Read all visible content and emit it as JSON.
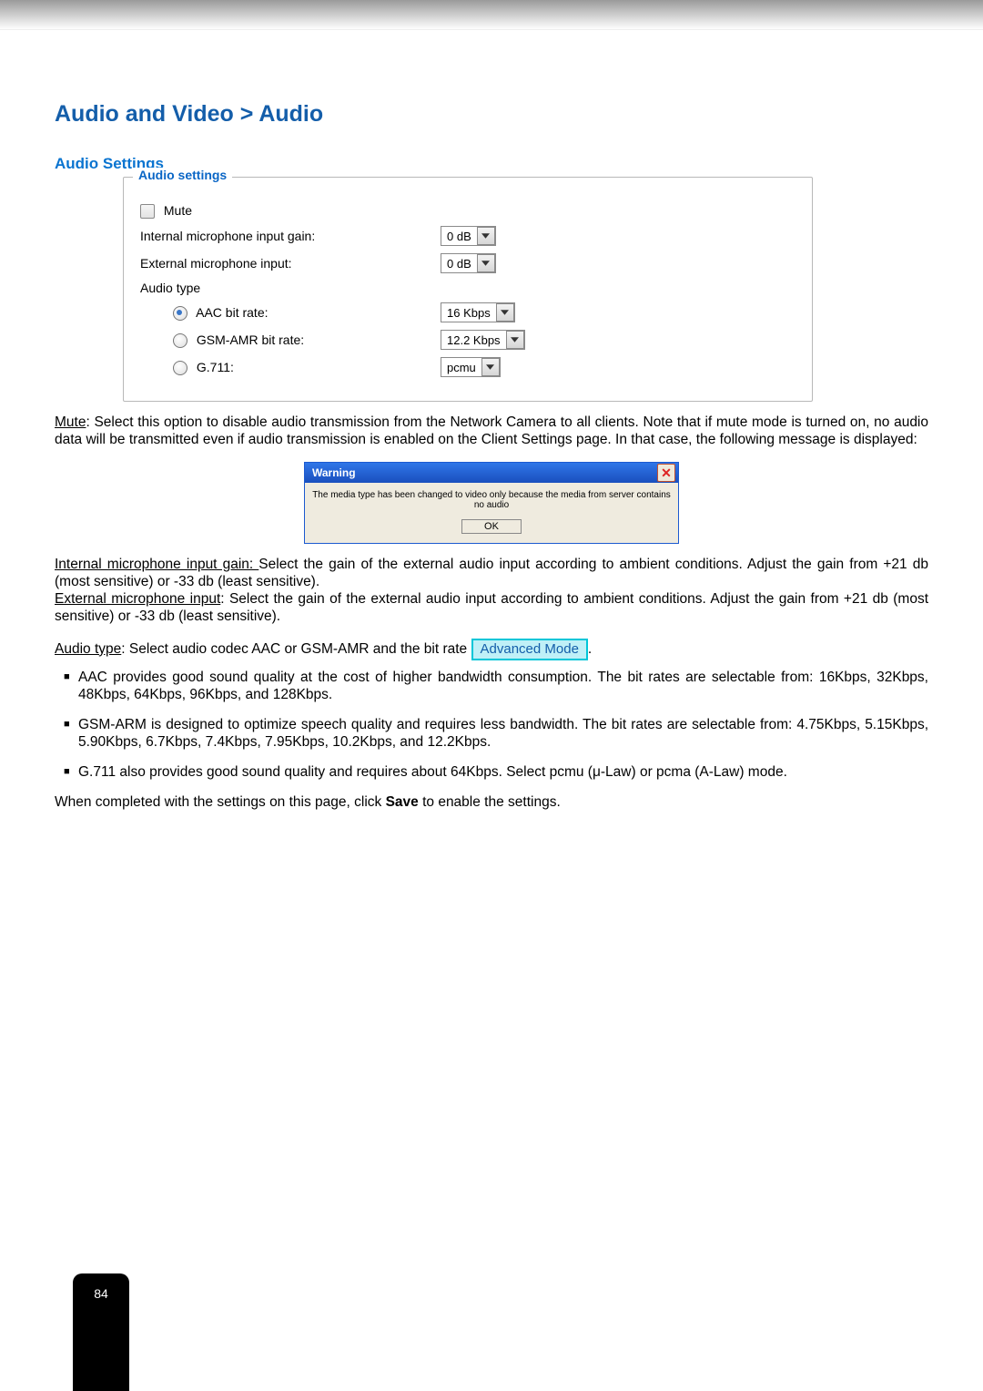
{
  "breadcrumb": "Audio and Video > Audio",
  "sectionTitle": "Audio Settings",
  "fieldset": {
    "legend": "Audio settings",
    "muteLabel": "Mute",
    "internalGainLabel": "Internal microphone input gain:",
    "internalGainValue": "0 dB",
    "externalInputLabel": "External microphone input:",
    "externalInputValue": "0 dB",
    "audioTypeLabel": "Audio type",
    "aacLabel": "AAC bit rate:",
    "aacValue": "16 Kbps",
    "gsmLabel": "GSM-AMR bit rate:",
    "gsmValue": "12.2 Kbps",
    "g711Label": "G.711:",
    "g711Value": "pcmu"
  },
  "muteParagraph": {
    "lead": "Mute",
    "text": ": Select this option to disable audio transmission from the Network Camera to all clients. Note that if mute mode is turned on, no audio data will be transmitted even if audio transmission is enabled on the Client Settings page. In that case, the following message is displayed:"
  },
  "dialog": {
    "title": "Warning",
    "message": "The media type has been changed to video only because the media from server contains no audio",
    "ok": "OK"
  },
  "internalPara": {
    "lead": "Internal microphone input gain: ",
    "text": "Select the gain of the external audio input according to ambient conditions. Adjust the gain from +21 db (most sensitive) or -33 db (least sensitive)."
  },
  "externalPara": {
    "lead": "External microphone input",
    "text": ": Select the gain of the external audio input according to ambient conditions. Adjust the gain from +21 db (most sensitive) or -33 db (least sensitive)."
  },
  "audioTypeLine": {
    "lead": "Audio type",
    "text": ": Select audio codec AAC or GSM-AMR and the bit rate ",
    "badge": "Advanced Mode",
    "after": "."
  },
  "bullets": {
    "aac": "AAC provides good sound quality at the cost of higher bandwidth consumption. The bit rates are selectable from: 16Kbps, 32Kbps, 48Kbps, 64Kbps, 96Kbps, and 128Kbps.",
    "gsm": "GSM-ARM is designed to optimize speech quality and requires less bandwidth. The bit rates are selectable from: 4.75Kbps, 5.15Kbps, 5.90Kbps, 6.7Kbps, 7.4Kbps, 7.95Kbps, 10.2Kbps, and 12.2Kbps.",
    "g711": "G.711 also provides good sound quality and requires about 64Kbps. Select pcmu (μ-Law) or pcma (A-Law) mode."
  },
  "closing": {
    "pre": "When completed with the settings on this page, click ",
    "bold": "Save",
    "post": " to enable the settings."
  },
  "pageNumber": "84"
}
